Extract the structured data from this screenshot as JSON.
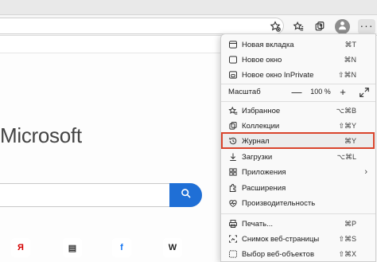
{
  "browser": {
    "avatar_icon": "person-icon",
    "more_label": "···"
  },
  "newtab": {
    "brand": "Microsoft",
    "tiles": [
      {
        "name": "yandex-tile",
        "glyph": "Я",
        "color": "#d40000"
      },
      {
        "name": "news-tile",
        "glyph": "▤",
        "color": "#333333"
      },
      {
        "name": "facebook-tile",
        "glyph": "f",
        "color": "#1877f2"
      },
      {
        "name": "wikipedia-tile",
        "glyph": "W",
        "color": "#222222"
      }
    ]
  },
  "menu": {
    "items": [
      {
        "label": "Новая вкладка",
        "shortcut": "⌘T",
        "icon": "new-tab-icon"
      },
      {
        "label": "Новое окно",
        "shortcut": "⌘N",
        "icon": "new-window-icon"
      },
      {
        "label": "Новое окно InPrivate",
        "shortcut": "⇧⌘N",
        "icon": "inprivate-icon"
      },
      {
        "label": "Избранное",
        "shortcut": "⌥⌘B",
        "icon": "favorites-icon"
      },
      {
        "label": "Коллекции",
        "shortcut": "⇧⌘Y",
        "icon": "collections-icon"
      },
      {
        "label": "Журнал",
        "shortcut": "⌘Y",
        "icon": "history-icon"
      },
      {
        "label": "Загрузки",
        "shortcut": "⌥⌘L",
        "icon": "downloads-icon"
      },
      {
        "label": "Приложения",
        "shortcut": "",
        "icon": "apps-icon",
        "submenu": "›"
      },
      {
        "label": "Расширения",
        "shortcut": "",
        "icon": "extensions-icon"
      },
      {
        "label": "Производительность",
        "shortcut": "",
        "icon": "performance-icon"
      },
      {
        "label": "Печать...",
        "shortcut": "⌘P",
        "icon": "print-icon"
      },
      {
        "label": "Снимок веб-страницы",
        "shortcut": "⇧⌘S",
        "icon": "screenshot-icon"
      },
      {
        "label": "Выбор веб-объектов",
        "shortcut": "⇧⌘X",
        "icon": "web-select-icon"
      }
    ],
    "zoom": {
      "label": "Масштаб",
      "minus": "—",
      "value": "100 %",
      "plus": "+"
    }
  },
  "colors": {
    "accent": "#1f6fd6",
    "highlight_border": "#d9442c"
  }
}
